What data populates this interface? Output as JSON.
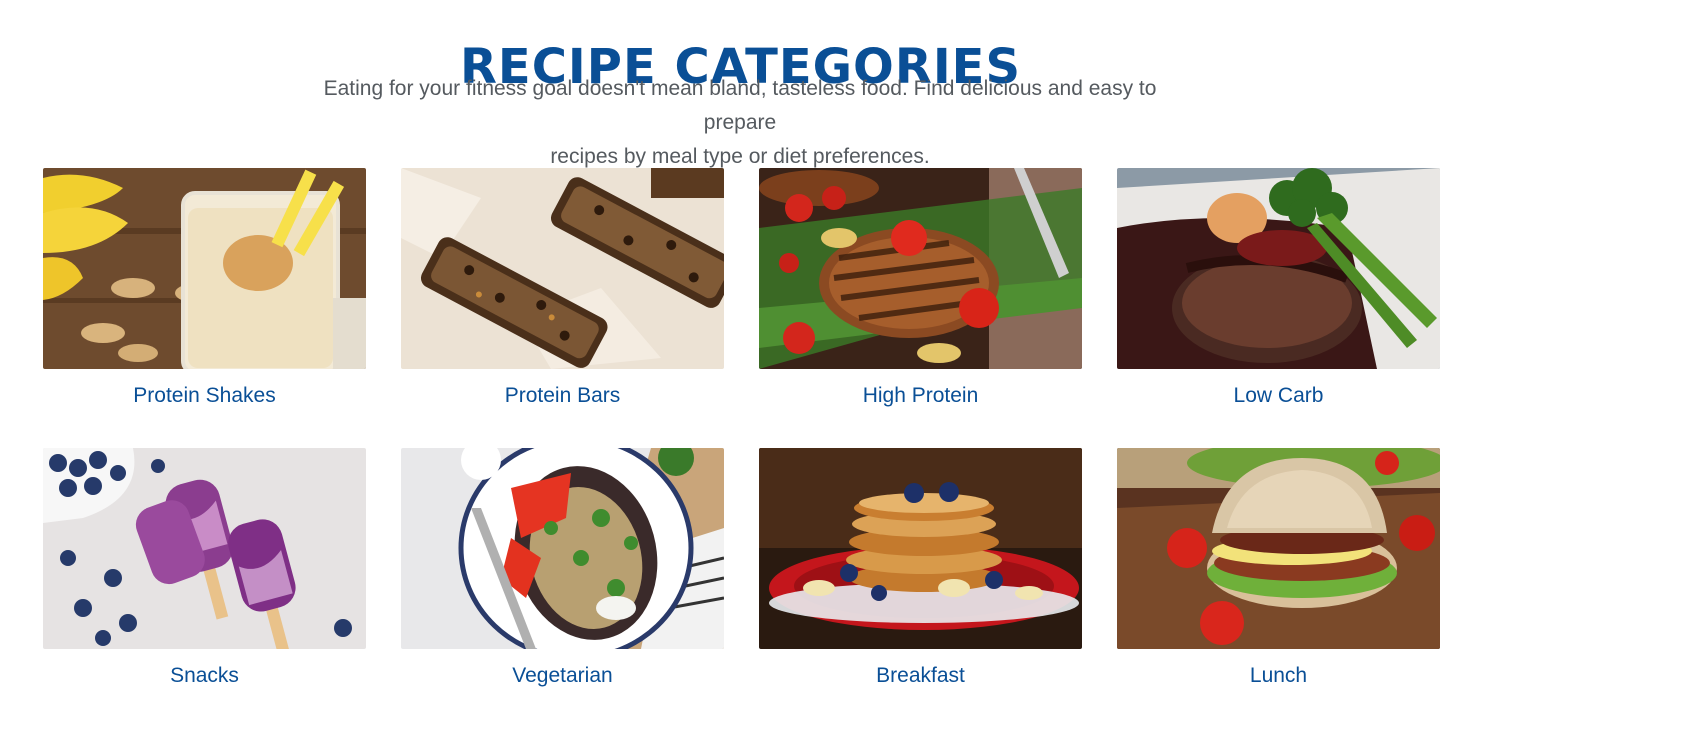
{
  "header": {
    "title": "RECIPE CATEGORIES",
    "subtitle_line1": "Eating for your fitness goal doesn't mean bland, tasteless food. Find delicious and easy to prepare",
    "subtitle_line2": "recipes by meal type or diet preferences."
  },
  "colors": {
    "accent": "#0a4f96",
    "text": "#555a5f"
  },
  "categories": [
    {
      "label": "Protein Shakes",
      "image": "protein-shakes-photo"
    },
    {
      "label": "Protein Bars",
      "image": "protein-bars-photo"
    },
    {
      "label": "High Protein",
      "image": "grilled-chicken-photo"
    },
    {
      "label": "Low Carb",
      "image": "steak-broccoli-photo"
    },
    {
      "label": "Snacks",
      "image": "blueberry-popsicles-photo"
    },
    {
      "label": "Vegetarian",
      "image": "stuffed-eggplant-photo"
    },
    {
      "label": "Breakfast",
      "image": "pancakes-photo"
    },
    {
      "label": "Lunch",
      "image": "sandwich-photo"
    }
  ]
}
